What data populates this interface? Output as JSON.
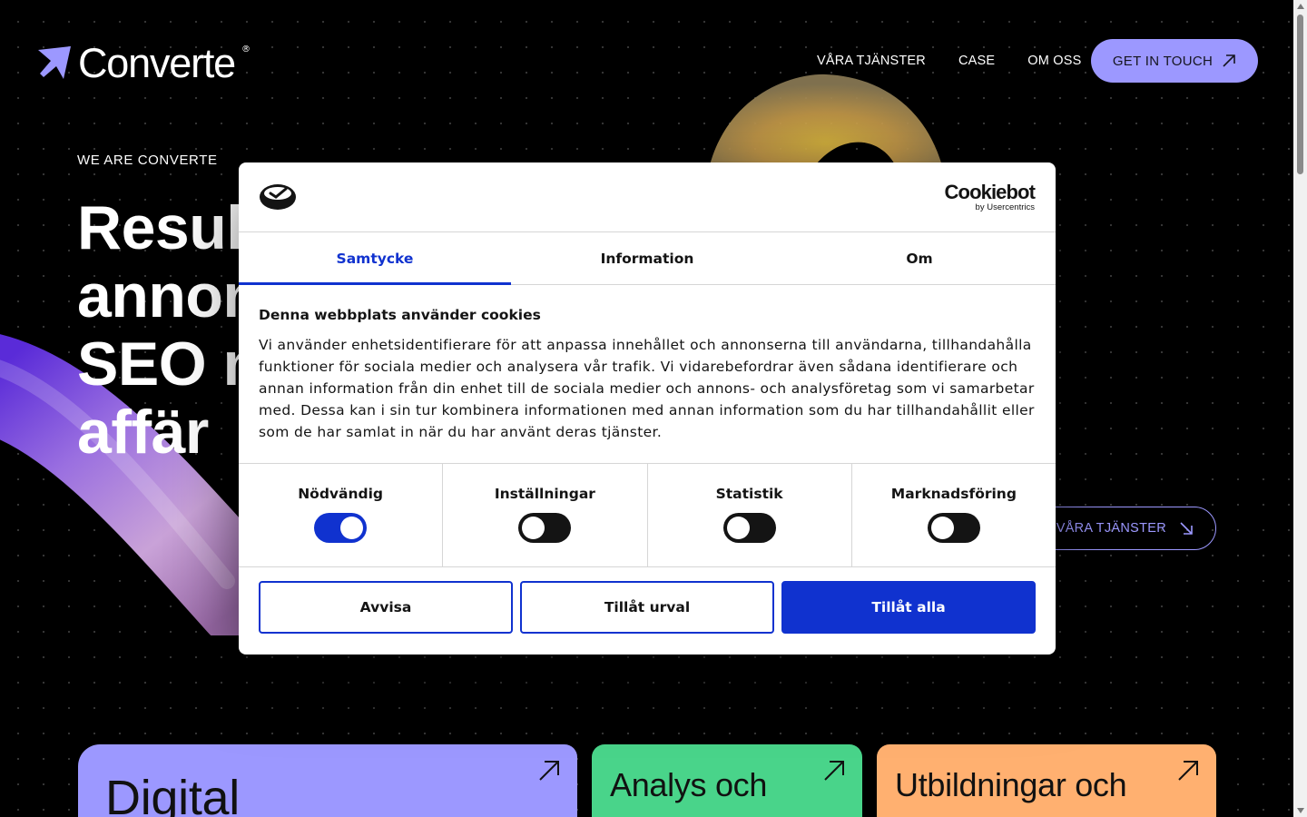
{
  "brand": {
    "name": "Converte",
    "registered": "®",
    "accent": "#9c98ff"
  },
  "nav": {
    "items": [
      "VÅRA TJÄNSTER",
      "CASE",
      "OM OSS"
    ],
    "cta": "GET IN TOUCH"
  },
  "hero": {
    "label": "WE ARE CONVERTE",
    "title_lines": [
      "Result",
      "annon",
      "SEO m",
      "affär"
    ],
    "button": "VÅRA TJÄNSTER"
  },
  "cards": [
    {
      "title": "Digital",
      "color": "#9c98ff"
    },
    {
      "title": "Analys och",
      "color": "#49d48a"
    },
    {
      "title": "Utbildningar och",
      "color": "#ffb070"
    }
  ],
  "cookie": {
    "brand": "Cookiebot",
    "brand_sub": "by Usercentrics",
    "tabs": [
      "Samtycke",
      "Information",
      "Om"
    ],
    "active_tab": "Samtycke",
    "heading": "Denna webbplats använder cookies",
    "text": "Vi använder enhetsidentifierare för att anpassa innehållet och annonserna till användarna, tillhandahålla funktioner för sociala medier och analysera vår trafik. Vi vidarebefordrar även sådana identifierare och annan information från din enhet till de sociala medier och annons- och analysföretag som vi samarbetar med. Dessa kan i sin tur kombinera informationen med annan information som du har tillhandahållit eller som de har samlat in när du har använt deras tjänster.",
    "toggles": [
      {
        "label": "Nödvändig",
        "on": true
      },
      {
        "label": "Inställningar",
        "on": false
      },
      {
        "label": "Statistik",
        "on": false
      },
      {
        "label": "Marknadsföring",
        "on": false
      }
    ],
    "buttons": {
      "reject": "Avvisa",
      "selection": "Tillåt urval",
      "allow_all": "Tillåt alla"
    },
    "accent": "#1032cf"
  }
}
